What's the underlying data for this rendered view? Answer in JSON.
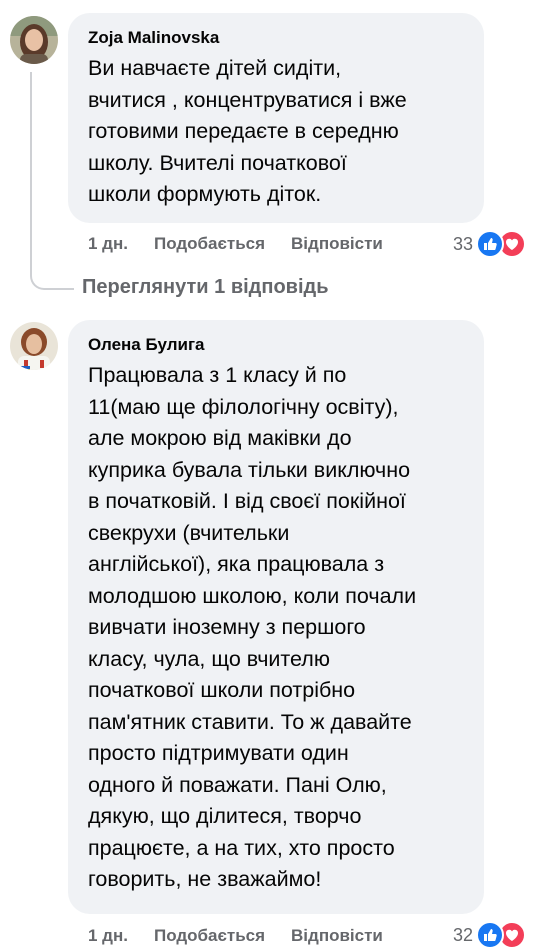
{
  "comments": [
    {
      "author": "Zoja Malinovska",
      "text": "Ви навчаєте дітей сидіти,\nвчитися , концентруватися і вже\nготовими передаєте в середню\nшколу. Вчителі початкової\nшколи формують діток.",
      "time": "1 дн.",
      "like_label": "Подобається",
      "reply_label": "Відповісти",
      "reaction_count": "33",
      "reactions": [
        "like-icon",
        "love-icon"
      ]
    },
    {
      "author": "Олена Булига",
      "text": "Працювала з 1 класу й по\n11(маю ще філологічну освіту),\nале мокрою від маківки до\nкуприка бувала тільки виключно\nв початковій. І від своєї покійної\nсвекрухи (вчительки\nанглійської), яка працювала з\nмолодшою школою, коли почали\nвивчати іноземну з першого\nкласу, чула, що вчителю\nпочаткової школи потрібно\nпам'ятник ставити. То ж давайте\nпросто підтримувати один\nодного й поважати. Пані Олю,\nдякую, що ділитеся, творчо\nпрацюєте, а на тих, хто просто\nговорить, не зважаймо!",
      "time": "1 дн.",
      "like_label": "Подобається",
      "reply_label": "Відповісти",
      "reaction_count": "32",
      "reactions": [
        "like-icon",
        "love-icon"
      ]
    }
  ],
  "view_replies_label": "Переглянути 1 відповідь",
  "colors": {
    "bubble": "#f0f2f5",
    "secondary_text": "#65676b",
    "like": "#1877f2",
    "love": "#f33e58"
  }
}
